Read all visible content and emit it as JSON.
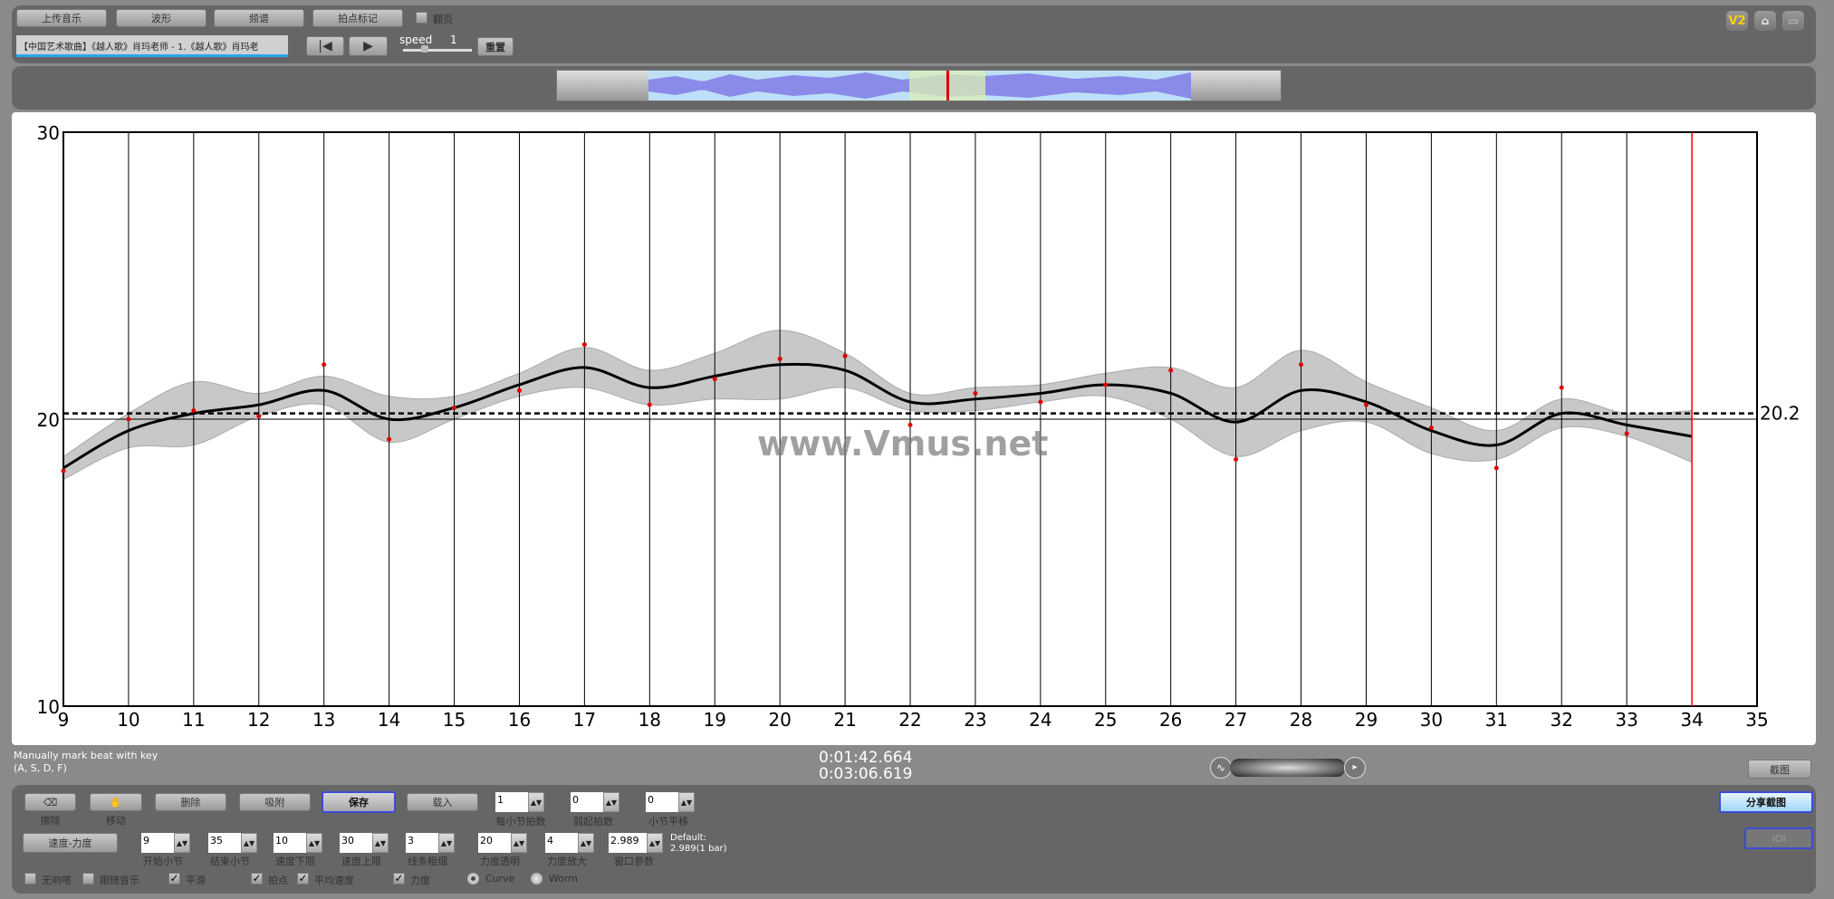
{
  "toolbar": {
    "upload": "上传音乐",
    "waveform": "波形",
    "spectrum": "频谱",
    "beat_mark": "拍点标记",
    "page_turn": "翻页",
    "song_title": "【中国艺术歌曲】《越人歌》肖玛老师 - 1.《越人歌》肖玛老",
    "speed_label": "speed",
    "speed_value": "1",
    "reset": "重置",
    "page_turn_checked": false
  },
  "top_icons": {
    "version": "V2",
    "home": "home-icon",
    "fullscreen": "fullscreen-icon"
  },
  "status": {
    "hint_line1": "Manually mark beat with key",
    "hint_line2": "(A, S, D, F)",
    "current_time": "0:01:42.664",
    "total_time": "0:03:06.619",
    "screenshot": "截图",
    "share_screenshot": "分享截图",
    "ioi": "IOI"
  },
  "controls": {
    "erase": "擦除",
    "move": "移动",
    "delete": "删除",
    "snap": "吸附",
    "save": "保存",
    "load": "载入",
    "beats_per_bar": {
      "label": "每小节拍数",
      "value": "1"
    },
    "pickup_beats": {
      "label": "弱起拍数",
      "value": "0"
    },
    "bar_shift": {
      "label": "小节平移",
      "value": "0"
    },
    "tempo_dynamics": "速度-力度",
    "start_bar": {
      "label": "开始小节",
      "value": "9"
    },
    "end_bar": {
      "label": "结束小节",
      "value": "35"
    },
    "tempo_min": {
      "label": "速度下限",
      "value": "10"
    },
    "tempo_max": {
      "label": "速度上限",
      "value": "30"
    },
    "line_width": {
      "label": "线条粗细",
      "value": "3"
    },
    "dyn_opacity": {
      "label": "力度透明",
      "value": "20"
    },
    "dyn_scale": {
      "label": "力度放大",
      "value": "4"
    },
    "window_param": {
      "label": "窗口参数",
      "value": "2.989"
    },
    "default_line1": "Default:",
    "default_line2": "2.989(1 bar)",
    "checks": [
      {
        "label": "无响嗒",
        "checked": false
      },
      {
        "label": "跟随音乐",
        "checked": false
      },
      {
        "label": "平滑",
        "checked": true
      },
      {
        "label": "拍点",
        "checked": true
      },
      {
        "label": "平均速度",
        "checked": true
      },
      {
        "label": "力度",
        "checked": true
      }
    ],
    "radio_curve": "Curve",
    "radio_worm": "Worm",
    "selected_mode": "Curve"
  },
  "watermark": "www.Vmus.net",
  "chart_data": {
    "type": "line",
    "xlim": [
      9,
      35
    ],
    "ylim": [
      10,
      30
    ],
    "x_ticks": [
      "9",
      "10",
      "11",
      "12",
      "13",
      "14",
      "15",
      "16",
      "17",
      "18",
      "19",
      "20",
      "21",
      "22",
      "23",
      "24",
      "25",
      "26",
      "27",
      "28",
      "29",
      "30",
      "31",
      "32",
      "33",
      "34",
      "35"
    ],
    "y_ticks": [
      "10",
      "20",
      "30"
    ],
    "beat_points": {
      "x": [
        9,
        10,
        11,
        12,
        13,
        14,
        15,
        16,
        17,
        18,
        19,
        20,
        21,
        22,
        23,
        24,
        25,
        26,
        27,
        28,
        29,
        30,
        31,
        32,
        33
      ],
      "y": [
        18.2,
        20.0,
        20.3,
        20.1,
        21.9,
        19.3,
        20.4,
        21.0,
        22.6,
        20.5,
        21.4,
        22.1,
        22.2,
        19.8,
        20.9,
        20.6,
        21.2,
        21.7,
        18.6,
        21.9,
        20.5,
        19.7,
        18.3,
        21.1,
        19.5
      ]
    },
    "smooth_curve": {
      "x": [
        9,
        10,
        11,
        12,
        13,
        14,
        15,
        16,
        17,
        18,
        19,
        20,
        21,
        22,
        23,
        24,
        25,
        26,
        27,
        28,
        29,
        30,
        31,
        32,
        33,
        34
      ],
      "y": [
        18.3,
        19.6,
        20.2,
        20.5,
        21.0,
        20.0,
        20.4,
        21.2,
        21.8,
        21.1,
        21.5,
        21.9,
        21.7,
        20.6,
        20.7,
        20.9,
        21.2,
        20.9,
        19.9,
        21.0,
        20.6,
        19.6,
        19.1,
        20.2,
        19.8,
        19.4
      ]
    },
    "dynamics_band_halfwidth": [
      0.4,
      0.6,
      1.1,
      0.4,
      0.5,
      0.8,
      0.4,
      0.4,
      0.7,
      0.6,
      0.8,
      1.2,
      0.6,
      0.3,
      0.4,
      0.3,
      0.4,
      0.9,
      1.2,
      1.4,
      0.7,
      0.8,
      0.5,
      0.5,
      0.4,
      0.9
    ],
    "average_tempo": 20.2,
    "average_label": "20.2",
    "cursor_x": 34,
    "colors": {
      "curve": "#000000",
      "points": "#e00000",
      "band": "#c8c8c8",
      "cursor": "#ff0000"
    }
  }
}
